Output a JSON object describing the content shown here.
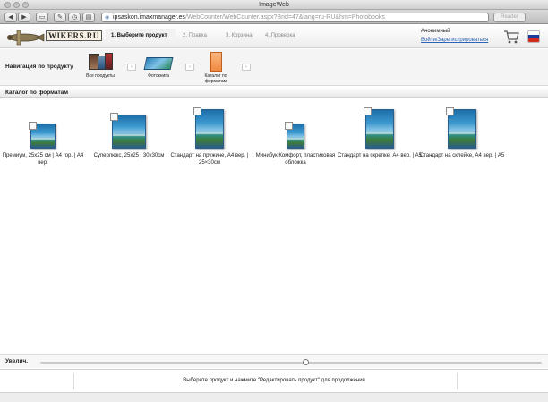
{
  "window": {
    "title": "ImageWeb"
  },
  "browser": {
    "url_host": "ipsaskon.imaxmanager.es",
    "url_path": "/WebCounter/WebCounter.aspx?Brid=47&lang=ru-RU&hm=Photobooks",
    "reader_label": "Reader"
  },
  "header": {
    "logo_text": "WIKERS.RU",
    "steps": [
      {
        "label": "1. Выберите продукт",
        "active": true
      },
      {
        "label": "2. Правка",
        "active": false
      },
      {
        "label": "3. Корзина",
        "active": false
      },
      {
        "label": "4. Проверка",
        "active": false
      }
    ],
    "user_name": "Анонимный",
    "login_link": "Войти/Зарегистрироваться"
  },
  "nav": {
    "title": "Навигация по продукту",
    "crumbs": [
      {
        "label": "Все продукты",
        "icon": "albums-icon"
      },
      {
        "label": "Фотокнига",
        "icon": "photobook-icon"
      },
      {
        "label": "Каталог по форматам",
        "icon": "format-icon"
      }
    ]
  },
  "catalog": {
    "title": "Каталог по форматам",
    "products": [
      {
        "label": "Премиум, 25x25 см | A4 гор. | A4 вер."
      },
      {
        "label": "Суперлюкс, 25x25 | 30x30см"
      },
      {
        "label": "Стандарт на пружине, A4 вер. | 25×30см"
      },
      {
        "label": "Минибук Комфорт, пластиковая обложка"
      },
      {
        "label": "Стандарт на скрепке, A4 вер. | A5"
      },
      {
        "label": "Стандарт на склейке, A4 вер. | A5"
      }
    ]
  },
  "footer": {
    "zoom_label": "Увелич.",
    "zoom_level": 0.53,
    "status_message": "Выберите продукт и нажмите \"Редактировать продукт\" для продолжения"
  },
  "colors": {
    "accent_link": "#2a63b8",
    "flag": [
      "#ffffff",
      "#1c3f9e",
      "#d52b1e"
    ]
  }
}
